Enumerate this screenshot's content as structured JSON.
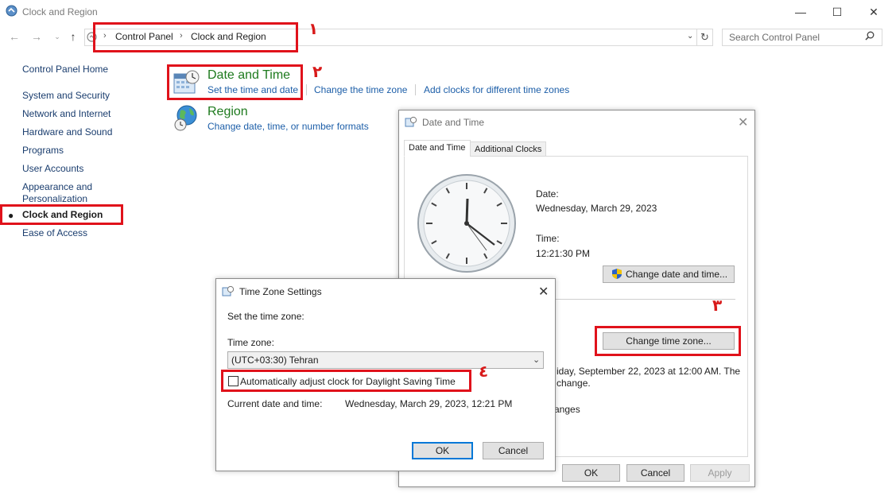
{
  "window": {
    "title": "Clock and Region",
    "minimize": "—",
    "maximize": "☐",
    "close": "✕"
  },
  "address_bar": {
    "breadcrumbs": [
      "Control Panel",
      "Clock and Region"
    ],
    "separator": "›",
    "search_placeholder": "Search Control Panel"
  },
  "sidebar": {
    "items": [
      {
        "label": "Control Panel Home"
      },
      {
        "label": "System and Security"
      },
      {
        "label": "Network and Internet"
      },
      {
        "label": "Hardware and Sound"
      },
      {
        "label": "Programs"
      },
      {
        "label": "User Accounts"
      },
      {
        "label": "Appearance and Personalization"
      },
      {
        "label": "Clock and Region",
        "active": true
      },
      {
        "label": "Ease of Access"
      }
    ]
  },
  "main": {
    "date_time": {
      "title": "Date and Time",
      "links": [
        "Set the time and date",
        "Change the time zone",
        "Add clocks for different time zones"
      ]
    },
    "region": {
      "title": "Region",
      "links": [
        "Change date, time, or number formats"
      ]
    }
  },
  "annotations": [
    "١",
    "٢",
    "٣",
    "٤"
  ],
  "date_time_dialog": {
    "title": "Date and Time",
    "tabs": [
      "Date and Time",
      "Additional Clocks"
    ],
    "date_label": "Date:",
    "date_value": "Wednesday, March 29, 2023",
    "time_label": "Time:",
    "time_value": "12:21:30 PM",
    "change_datetime_button": "Change date and time...",
    "change_timezone_button": "Change time zone...",
    "dst_text_line1": "iday, September 22, 2023 at 12:00 AM. The",
    "dst_text_line2": "change.",
    "dst_text_line3": "anges",
    "ok": "OK",
    "cancel": "Cancel",
    "apply": "Apply"
  },
  "timezone_dialog": {
    "title": "Time Zone Settings",
    "set_label": "Set the time zone:",
    "tz_label": "Time zone:",
    "tz_value": "(UTC+03:30) Tehran",
    "dst_checkbox": "Automatically adjust clock for Daylight Saving Time",
    "dst_checked": false,
    "current_label": "Current date and time:",
    "current_value": "Wednesday, March 29, 2023, 12:21 PM",
    "ok": "OK",
    "cancel": "Cancel"
  },
  "colors": {
    "highlight": "#e0121b",
    "link": "#1c5ea8",
    "category_title": "#1e7a1e",
    "focus": "#0078d7"
  }
}
